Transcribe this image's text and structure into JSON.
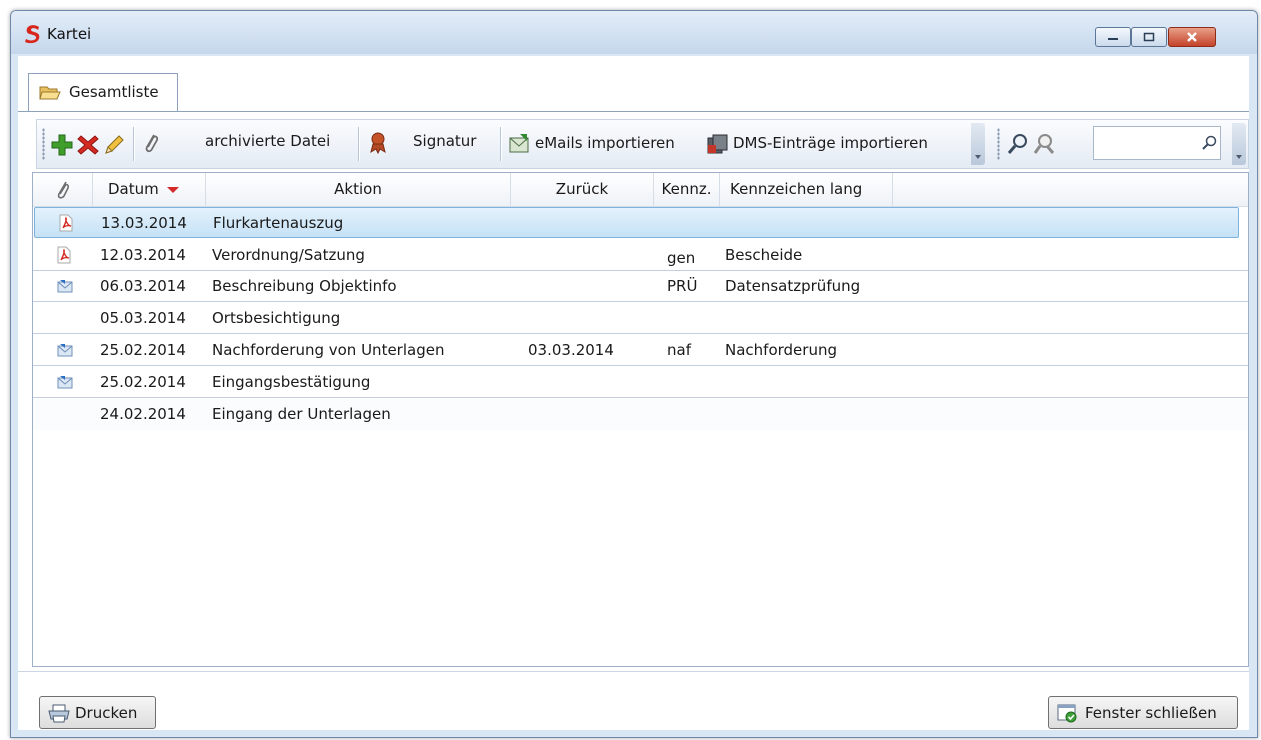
{
  "window": {
    "title": "Kartei",
    "controls": {
      "minimize": "minimize-icon",
      "maximize": "maximize-icon",
      "close": "close-icon"
    }
  },
  "tabs": [
    {
      "label": "Gesamtliste",
      "icon": "folder-open-icon",
      "active": true
    }
  ],
  "toolbar": {
    "add_icon": "plus-icon",
    "delete_icon": "delete-x-icon",
    "edit_icon": "pencil-icon",
    "attach_icon": "paperclip-icon",
    "archived_file_label": "archivierte Datei",
    "signature_icon": "seal-icon",
    "signature_label": "Signatur",
    "import_emails_label": "eMails importieren",
    "import_dms_label": "DMS-Einträge importieren",
    "search_icon": "magnifier-icon",
    "search_placeholder": ""
  },
  "grid": {
    "columns": [
      "",
      "Datum",
      "Aktion",
      "Zurück",
      "Kennz.",
      "Kennzeichen lang"
    ],
    "sort_column": "Datum",
    "sort_direction": "descending",
    "rows": [
      {
        "icon": "pdf-icon",
        "datum": "13.03.2014",
        "aktion": "Flurkartenauszug",
        "zurueck": "",
        "kennz": "",
        "kennzeichen_lang": "",
        "selected": true
      },
      {
        "icon": "pdf-icon",
        "datum": "12.03.2014",
        "aktion": "Verordnung/Satzung",
        "zurueck": "",
        "kennz": "gen",
        "kennzeichen_lang": "Bescheide",
        "selected": false
      },
      {
        "icon": "email-icon",
        "datum": "06.03.2014",
        "aktion": "Beschreibung Objektinfo",
        "zurueck": "",
        "kennz": "PRÜ",
        "kennzeichen_lang": "Datensatzprüfung",
        "selected": false
      },
      {
        "icon": "",
        "datum": "05.03.2014",
        "aktion": "Ortsbesichtigung",
        "zurueck": "",
        "kennz": "",
        "kennzeichen_lang": "",
        "selected": false
      },
      {
        "icon": "email-icon",
        "datum": "25.02.2014",
        "aktion": "Nachforderung von Unterlagen",
        "zurueck": "03.03.2014",
        "kennz": "naf",
        "kennzeichen_lang": "Nachforderung",
        "selected": false
      },
      {
        "icon": "email-icon",
        "datum": "25.02.2014",
        "aktion": "Eingangsbestätigung",
        "zurueck": "",
        "kennz": "",
        "kennzeichen_lang": "",
        "selected": false
      },
      {
        "icon": "",
        "datum": "24.02.2014",
        "aktion": "Eingang der Unterlagen",
        "zurueck": "",
        "kennz": "",
        "kennzeichen_lang": "",
        "selected": false
      }
    ]
  },
  "footer": {
    "print_label": "Drucken",
    "close_window_label": "Fenster schließen"
  },
  "colors": {
    "selection": "#c5e1f6",
    "sort_arrow": "#d42a2a",
    "close_button": "#c4432a"
  }
}
